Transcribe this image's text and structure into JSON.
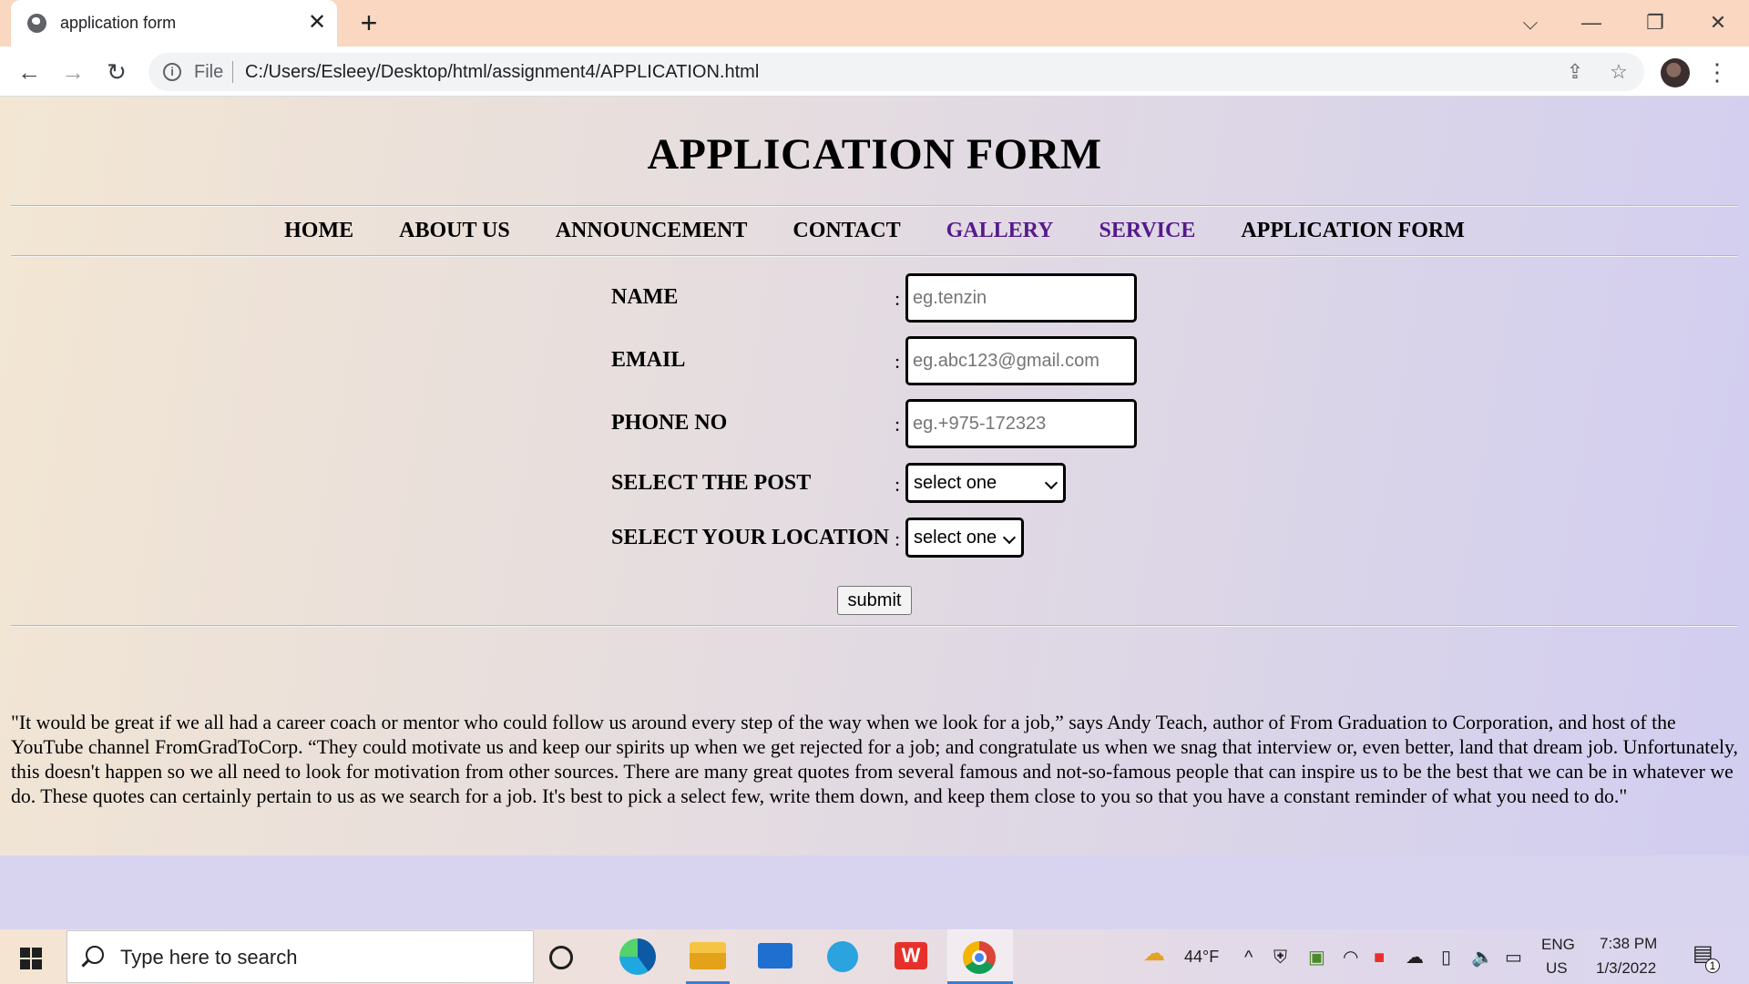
{
  "browser": {
    "tab_title": "application form",
    "new_tab": "+",
    "tab_close": "✕",
    "file_label": "File",
    "url": "C:/Users/Esleey/Desktop/html/assignment4/APPLICATION.html"
  },
  "page": {
    "title": "APPLICATION FORM",
    "nav": [
      {
        "label": "HOME",
        "visited": false
      },
      {
        "label": "ABOUT US",
        "visited": false
      },
      {
        "label": "ANNOUNCEMENT",
        "visited": false
      },
      {
        "label": "CONTACT",
        "visited": false
      },
      {
        "label": "GALLERY",
        "visited": true
      },
      {
        "label": "SERVICE",
        "visited": true
      },
      {
        "label": "APPLICATION FORM",
        "visited": false
      }
    ],
    "colors": {
      "visited_link": "#551a8b",
      "text": "#000000"
    }
  },
  "form": {
    "name_label": "NAME",
    "name_placeholder": "eg.tenzin",
    "email_label": "EMAIL",
    "email_placeholder": "eg.abc123@gmail.com",
    "phone_label": "PHONE NO",
    "phone_placeholder": "eg.+975-172323",
    "post_label": "SELECT THE POST",
    "post_value": "select one",
    "location_label": "SELECT YOUR LOCATION",
    "location_value": "select one",
    "colon": ":",
    "submit_label": "submit"
  },
  "quote": "\"It would be great if we all had a career coach or mentor who could follow us around every step of the way when we look for a job,” says Andy Teach, author of From Graduation to Corporation, and host of the YouTube channel FromGradToCorp. “They could motivate us and keep our spirits up when we get rejected for a job; and congratulate us when we snag that interview or, even better, land that dream job. Unfortunately, this doesn't happen so we all need to look for motivation from other sources. There are many great quotes from several famous and not-so-famous people that can inspire us to be the best that we can be in whatever we do. These quotes can certainly pertain to us as we search for a job. It's best to pick a select few, write them down, and keep them close to you so that you have a constant reminder of what you need to do.\"",
  "taskbar": {
    "search_placeholder": "Type here to search",
    "weather": "44°F",
    "lang_top": "ENG",
    "lang_bottom": "US",
    "time": "7:38 PM",
    "date": "1/3/2022",
    "notification_count": "1",
    "pinned_apps": [
      "cortana-icon",
      "edge-icon",
      "file-explorer-icon",
      "mail-icon",
      "telegram-icon",
      "wps-office-icon",
      "chrome-icon"
    ]
  }
}
